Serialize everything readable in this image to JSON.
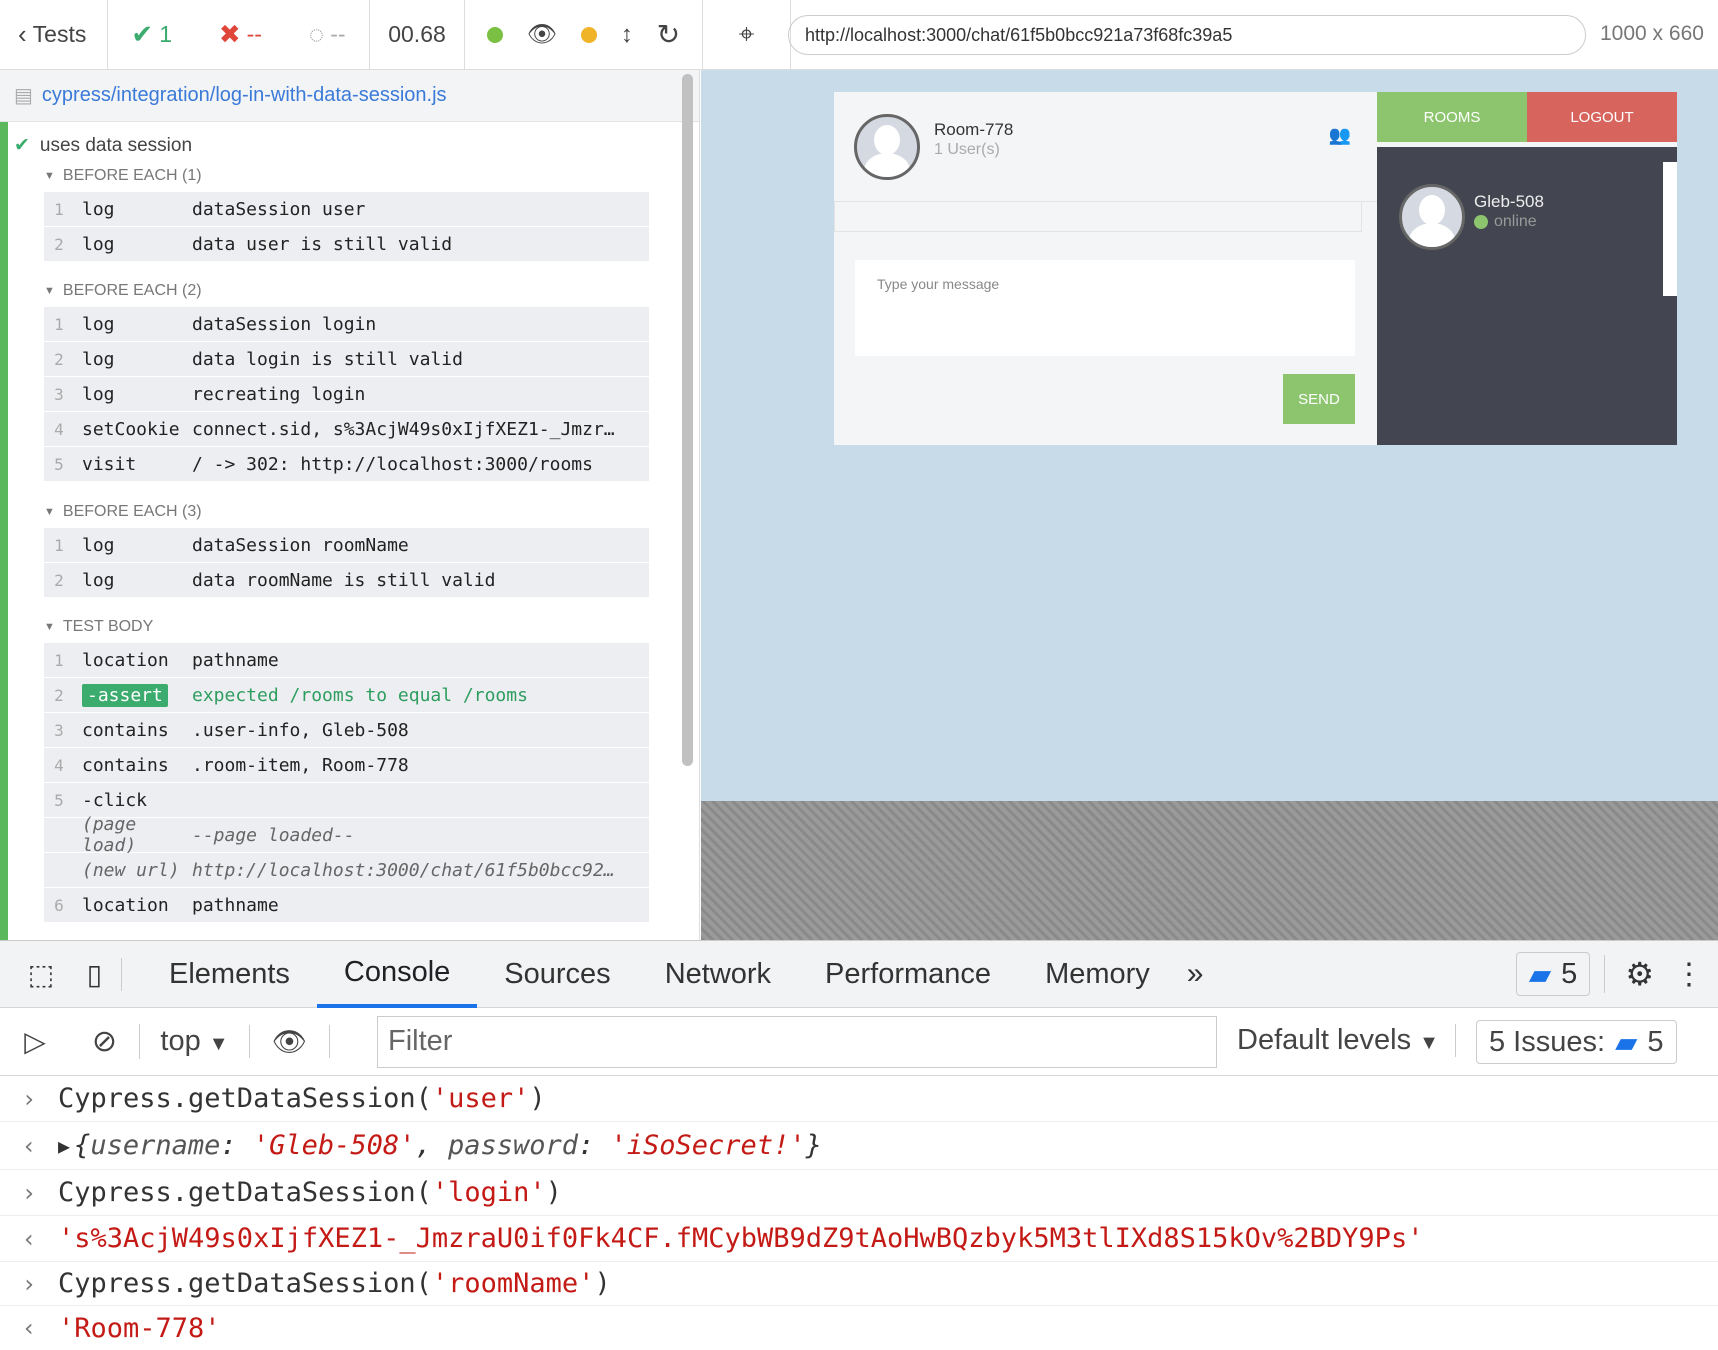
{
  "toolbar": {
    "tests_label": "Tests",
    "passed": "1",
    "failed": "--",
    "pending": "--",
    "duration": "00.68",
    "url": "http://localhost:3000/chat/61f5b0bcc921a73f68fc39a5",
    "viewport": "1000 x 660"
  },
  "reporter": {
    "spec_path": "cypress/integration/log-in-with-data-session.js",
    "test_title": "uses data session",
    "sections": [
      {
        "title": "BEFORE EACH (1)",
        "commands": [
          {
            "num": "1",
            "name": "log",
            "msg": "dataSession user"
          },
          {
            "num": "2",
            "name": "log",
            "msg": "data user is still valid"
          }
        ]
      },
      {
        "title": "BEFORE EACH (2)",
        "commands": [
          {
            "num": "1",
            "name": "log",
            "msg": "dataSession login"
          },
          {
            "num": "2",
            "name": "log",
            "msg": "data login is still valid"
          },
          {
            "num": "3",
            "name": "log",
            "msg": "recreating login"
          },
          {
            "num": "4",
            "name": "setCookie",
            "msg": "connect.sid, s%3AcjW49s0xIjfXEZ1-_Jmzr…"
          },
          {
            "num": "5",
            "name": "visit",
            "msg": "/ -> 302: http://localhost:3000/rooms"
          }
        ]
      },
      {
        "title": "BEFORE EACH (3)",
        "commands": [
          {
            "num": "1",
            "name": "log",
            "msg": "dataSession roomName"
          },
          {
            "num": "2",
            "name": "log",
            "msg": "data roomName is still valid"
          }
        ]
      },
      {
        "title": "TEST BODY",
        "commands": [
          {
            "num": "1",
            "name": "location",
            "msg": "pathname"
          },
          {
            "num": "2",
            "name": "-assert",
            "msg": "expected /rooms to equal /rooms"
          },
          {
            "num": "3",
            "name": "contains",
            "msg": ".user-info, Gleb-508"
          },
          {
            "num": "4",
            "name": "contains",
            "msg": ".room-item, Room-778"
          },
          {
            "num": "5",
            "name": "-click",
            "msg": ""
          },
          {
            "num": "",
            "name": "(page load)",
            "msg": "--page loaded--"
          },
          {
            "num": "",
            "name": "(new url)",
            "msg": "http://localhost:3000/chat/61f5b0bcc92…"
          },
          {
            "num": "6",
            "name": "location",
            "msg": "pathname"
          }
        ]
      }
    ]
  },
  "app": {
    "room_name": "Room-778",
    "user_count": "1 User(s)",
    "message_placeholder": "Type your message",
    "send_label": "SEND",
    "rooms_label": "ROOMS",
    "logout_label": "LOGOUT",
    "user_name": "Gleb-508",
    "user_status": "online"
  },
  "devtools": {
    "tabs": [
      "Elements",
      "Console",
      "Sources",
      "Network",
      "Performance",
      "Memory"
    ],
    "messages_count": "5",
    "context": "top",
    "filter_placeholder": "Filter",
    "levels": "Default levels",
    "issues_label": "5 Issues:",
    "issues_count": "5",
    "console": {
      "in1_a": "Cypress.getDataSession(",
      "in1_b": "'user'",
      "in1_c": ")",
      "out1_open": "{",
      "out1_k1": "username",
      "out1_v1": "'Gleb-508'",
      "out1_k2": "password",
      "out1_v2": "'iSoSecret!'",
      "out1_close": "}",
      "in2_a": "Cypress.getDataSession(",
      "in2_b": "'login'",
      "in2_c": ")",
      "out2": "'s%3AcjW49s0xIjfXEZ1-_JmzraU0if0Fk4CF.fMCybWB9dZ9tAoHwBQzbyk5M3tlIXd8S15kOv%2BDY9Ps'",
      "in3_a": "Cypress.getDataSession(",
      "in3_b": "'roomName'",
      "in3_c": ")",
      "out3": "'Room-778'"
    }
  },
  "colors": {
    "pass_green": "#5cb85c",
    "fail_red": "#e0453a",
    "accent_blue": "#1a73e8",
    "app_bg": "#c8dbe9",
    "send_green": "#8cc56e",
    "logout_red": "#d8645e",
    "sidebar_dark": "#434650"
  }
}
